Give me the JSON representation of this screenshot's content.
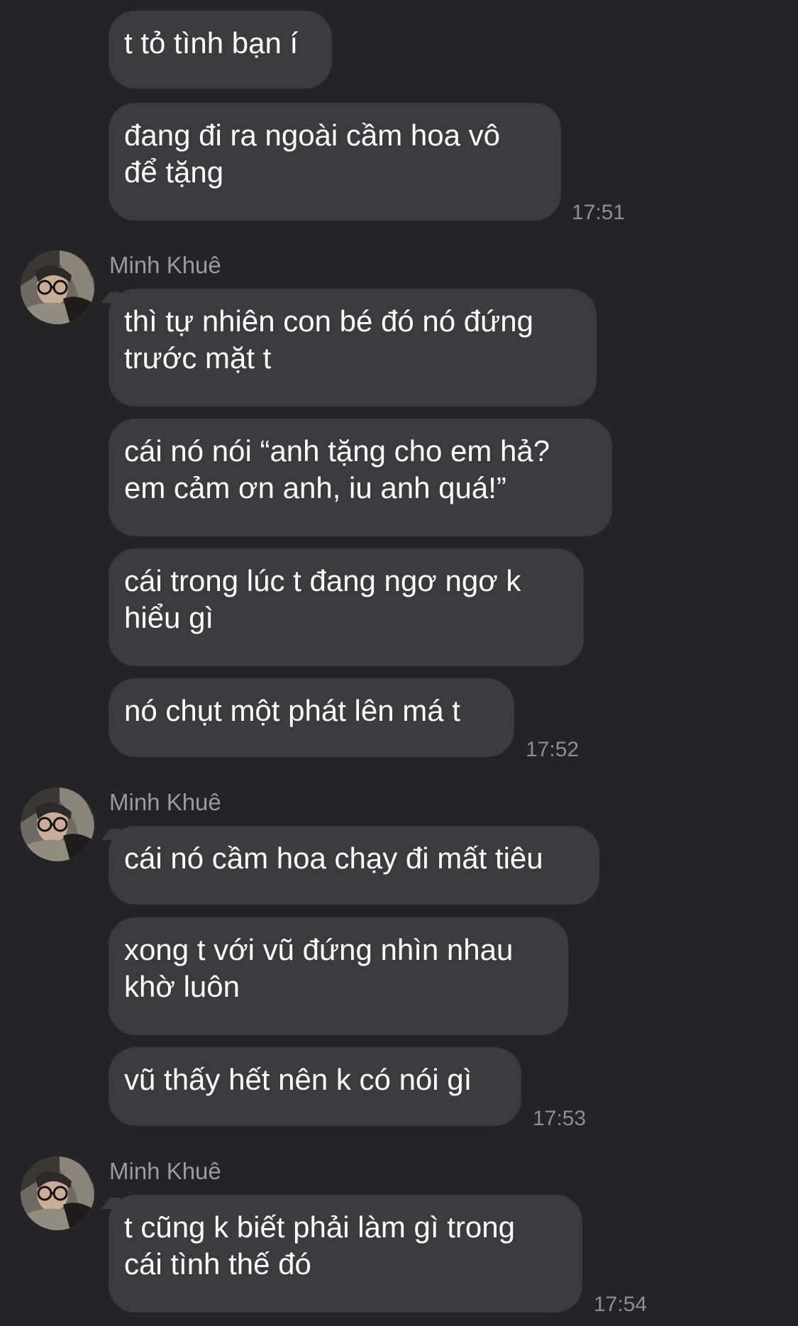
{
  "messages": [
    {
      "text": "t tỏ tình bạn í"
    },
    {
      "text": "đang đi ra ngoài cầm hoa vô\nđể tặng",
      "time": "17:51"
    },
    {
      "sender": "Minh Khuê",
      "avatar_icon": "user-avatar-photo",
      "text": "thì tự nhiên con bé đó nó đứng\ntrước mặt t"
    },
    {
      "text": "cái nó nói “anh tặng cho em hả?\nem cảm ơn anh, iu anh quá!”"
    },
    {
      "text": "cái trong lúc t đang ngơ ngơ k\nhiểu gì"
    },
    {
      "text": "nó chụt một phát lên má t",
      "time": "17:52"
    },
    {
      "sender": "Minh Khuê",
      "avatar_icon": "user-avatar-photo",
      "text": "cái nó cầm hoa chạy đi mất tiêu"
    },
    {
      "text": "xong t với vũ đứng nhìn nhau\nkhờ luôn"
    },
    {
      "text": "vũ thấy hết nên k có nói gì",
      "time": "17:53"
    },
    {
      "sender": "Minh Khuê",
      "avatar_icon": "user-avatar-photo",
      "text": "t cũng k biết phải làm gì trong\ncái tình thế đó",
      "time": "17:54"
    }
  ],
  "colors": {
    "background": "#242426",
    "bubble": "#3b3b3d",
    "text": "#ffffff",
    "meta": "#8e8e93"
  }
}
